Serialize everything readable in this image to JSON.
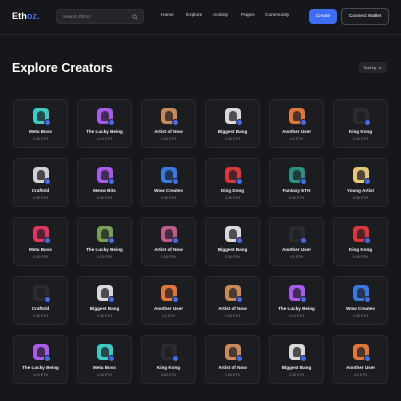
{
  "header": {
    "logo_main": "Eth",
    "logo_accent": "oz.",
    "search_placeholder": "Search Ethoz",
    "nav": [
      "Home",
      "Explore",
      "Activity",
      "Pages",
      "Community"
    ],
    "create_label": "Create",
    "wallet_label": "Connect Wallet"
  },
  "page": {
    "title": "Explore Creators",
    "sort_label": "Sort by"
  },
  "colors": {
    "accent": "#3d6df2",
    "background": "#16171b",
    "card": "#1c1d21"
  },
  "creators": [
    {
      "name": "Meta Boss",
      "eth": "0.25 ETH",
      "color": "#3fc9c1",
      "icon": "avatar-icon"
    },
    {
      "name": "The Lucky Being",
      "eth": "4.10 ETH",
      "color": "#a85be8",
      "icon": "avatar-icon"
    },
    {
      "name": "Artist of Now",
      "eth": "1.50 ETH",
      "color": "#c98a5a",
      "icon": "avatar-icon"
    },
    {
      "name": "Biggest Bang",
      "eth": "3.30 ETH",
      "color": "#d9d9dc",
      "icon": "avatar-icon"
    },
    {
      "name": "Another User",
      "eth": "4.0 ETH",
      "color": "#e0773a",
      "icon": "avatar-icon"
    },
    {
      "name": "King Kong",
      "eth": "5.60 ETH",
      "color": "#2b2c32",
      "icon": "avatar-icon"
    },
    {
      "name": "Craftold",
      "eth": "4.39 ETH",
      "color": "#cfd0d4",
      "icon": "avatar-icon"
    },
    {
      "name": "Meow Bits",
      "eth": "6.30 ETH",
      "color": "#a85be8",
      "icon": "avatar-icon"
    },
    {
      "name": "Wow Creates",
      "eth": "2.39 ETH",
      "color": "#3a78e0",
      "icon": "avatar-icon"
    },
    {
      "name": "Ding Dong",
      "eth": "2.00 ETH",
      "color": "#d9373b",
      "icon": "avatar-icon"
    },
    {
      "name": "Fantasy ETH",
      "eth": "5.60 ETH",
      "color": "#2d8f7f",
      "icon": "avatar-icon"
    },
    {
      "name": "Young Artist",
      "eth": "8.00 ETH",
      "color": "#e7c77a",
      "icon": "avatar-icon"
    },
    {
      "name": "Meta Boss",
      "eth": "0.25 ETH",
      "color": "#e0355e",
      "icon": "avatar-icon"
    },
    {
      "name": "The Lucky Being",
      "eth": "4.10 ETH",
      "color": "#7a9e5a",
      "icon": "avatar-icon"
    },
    {
      "name": "Artist of Now",
      "eth": "1.50 ETH",
      "color": "#c05a8a",
      "icon": "avatar-icon"
    },
    {
      "name": "Biggest Bang",
      "eth": "3.30 ETH",
      "color": "#d9d9dc",
      "icon": "avatar-icon"
    },
    {
      "name": "Another User",
      "eth": "4.0 ETH",
      "color": "#2b2c32",
      "icon": "avatar-icon"
    },
    {
      "name": "King Kong",
      "eth": "5.60 ETH",
      "color": "#d9373b",
      "icon": "avatar-icon"
    },
    {
      "name": "Craftold",
      "eth": "4.39 ETH",
      "color": "#2b2c32",
      "icon": "avatar-icon"
    },
    {
      "name": "Biggest Bang",
      "eth": "3.30 ETH",
      "color": "#d9d9dc",
      "icon": "avatar-icon"
    },
    {
      "name": "Another User",
      "eth": "4.0 ETH",
      "color": "#e0773a",
      "icon": "avatar-icon"
    },
    {
      "name": "Artist of Now",
      "eth": "1.50 ETH",
      "color": "#c98a5a",
      "icon": "avatar-icon"
    },
    {
      "name": "The Lucky Being",
      "eth": "4.10 ETH",
      "color": "#a85be8",
      "icon": "avatar-icon"
    },
    {
      "name": "Wow Creates",
      "eth": "2.39 ETH",
      "color": "#3a78e0",
      "icon": "avatar-icon"
    },
    {
      "name": "The Lucky Being",
      "eth": "4.10 ETH",
      "color": "#a85be8",
      "icon": "avatar-icon"
    },
    {
      "name": "Meta Boss",
      "eth": "0.25 ETH",
      "color": "#3fc9c1",
      "icon": "avatar-icon"
    },
    {
      "name": "King Kong",
      "eth": "5.60 ETH",
      "color": "#2b2c32",
      "icon": "avatar-icon"
    },
    {
      "name": "Artist of Now",
      "eth": "1.50 ETH",
      "color": "#c98a5a",
      "icon": "avatar-icon"
    },
    {
      "name": "Biggest Bang",
      "eth": "3.30 ETH",
      "color": "#d9d9dc",
      "icon": "avatar-icon"
    },
    {
      "name": "Another User",
      "eth": "4.0 ETH",
      "color": "#e0773a",
      "icon": "avatar-icon"
    }
  ]
}
